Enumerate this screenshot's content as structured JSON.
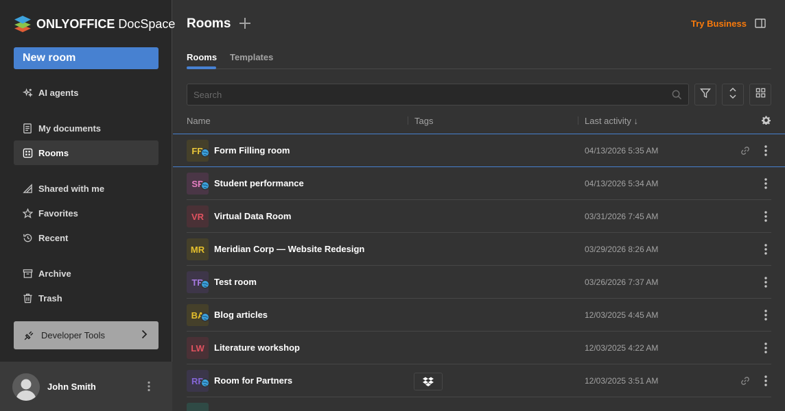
{
  "app": {
    "logo_brand": "ONLYOFFICE",
    "logo_product": "DocSpace"
  },
  "sidebar": {
    "new_room_label": "New room",
    "items": [
      {
        "label": "AI agents",
        "icon": "ai-agents-icon"
      },
      {
        "label": "My documents",
        "icon": "document-icon"
      },
      {
        "label": "Rooms",
        "icon": "rooms-icon",
        "active": true
      },
      {
        "label": "Shared with me",
        "icon": "shared-icon"
      },
      {
        "label": "Favorites",
        "icon": "star-icon"
      },
      {
        "label": "Recent",
        "icon": "history-icon"
      },
      {
        "label": "Archive",
        "icon": "archive-icon"
      },
      {
        "label": "Trash",
        "icon": "trash-icon"
      }
    ],
    "developer_tools_label": "Developer Tools",
    "user_name": "John Smith"
  },
  "header": {
    "title": "Rooms",
    "try_business": "Try Business"
  },
  "tabs": [
    {
      "label": "Rooms",
      "active": true
    },
    {
      "label": "Templates",
      "active": false
    }
  ],
  "search": {
    "placeholder": "Search",
    "value": ""
  },
  "table": {
    "columns": [
      "Name",
      "Tags",
      "Last activity ↓"
    ],
    "rows": [
      {
        "initials": "FR",
        "name": "Form Filling room",
        "date": "04/13/2026 5:35 AM",
        "color": "#e8c63a",
        "bg": "#45402a",
        "public": true,
        "link": true,
        "tag": ""
      },
      {
        "initials": "SP",
        "name": "Student performance",
        "date": "04/13/2026 5:34 AM",
        "color": "#e47ec0",
        "bg": "#4a3646",
        "public": true,
        "link": false,
        "tag": ""
      },
      {
        "initials": "VR",
        "name": "Virtual Data Room",
        "date": "03/31/2026 7:45 AM",
        "color": "#e0525f",
        "bg": "#4a3136",
        "public": false,
        "link": false,
        "tag": ""
      },
      {
        "initials": "MR",
        "name": "Meridian Corp — Website Redesign",
        "date": "03/29/2026 8:26 AM",
        "color": "#e6c02c",
        "bg": "#45402a",
        "public": false,
        "link": false,
        "tag": ""
      },
      {
        "initials": "TR",
        "name": "Test room",
        "date": "03/26/2026 7:37 AM",
        "color": "#a779e0",
        "bg": "#3e3649",
        "public": true,
        "link": false,
        "tag": ""
      },
      {
        "initials": "BA",
        "name": "Blog articles",
        "date": "12/03/2025 4:45 AM",
        "color": "#e6c02c",
        "bg": "#45402a",
        "public": true,
        "link": false,
        "tag": ""
      },
      {
        "initials": "LW",
        "name": "Literature workshop",
        "date": "12/03/2025 4:22 AM",
        "color": "#e0525f",
        "bg": "#4a3136",
        "public": false,
        "link": false,
        "tag": ""
      },
      {
        "initials": "RP",
        "name": "Room for Partners",
        "date": "12/03/2025 3:51 AM",
        "color": "#8466d6",
        "bg": "#3b364a",
        "public": true,
        "link": true,
        "tag": "dropbox-icon"
      }
    ]
  }
}
